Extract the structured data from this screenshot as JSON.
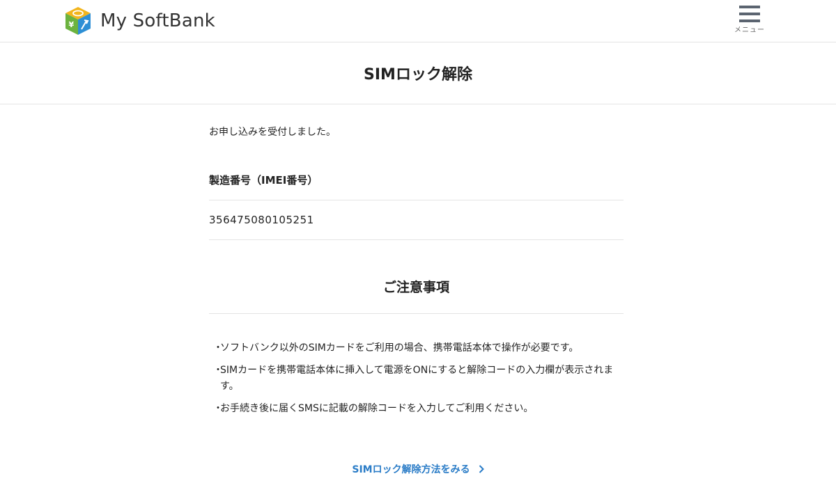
{
  "header": {
    "brand": "My SoftBank",
    "menu_label": "メニュー"
  },
  "page": {
    "title": "SIMロック解除"
  },
  "content": {
    "receipt_message": "お申し込みを受付しました。",
    "imei_label": "製造番号（IMEI番号）",
    "imei_value": "356475080105251",
    "notice_title": "ご注意事項",
    "notes": [
      "ソフトバンク以外のSIMカードをご利用の場合、携帯電話本体で操作が必要です。",
      "SIMカードを携帯電話本体に挿入して電源をONにすると解除コードの入力欄が表示されます。",
      "お手続き後に届くSMSに記載の解除コードを入力してご利用ください。"
    ],
    "bullet": "・",
    "link_label": "SIMロック解除方法をみる"
  },
  "icons": {
    "logo": "softbank-cube-logo-icon",
    "menu": "hamburger-menu-icon",
    "link_arrow": "chevron-right-icon"
  },
  "colors": {
    "link": "#2a7cc7",
    "divider": "#e4e4e4",
    "text": "#222222"
  }
}
